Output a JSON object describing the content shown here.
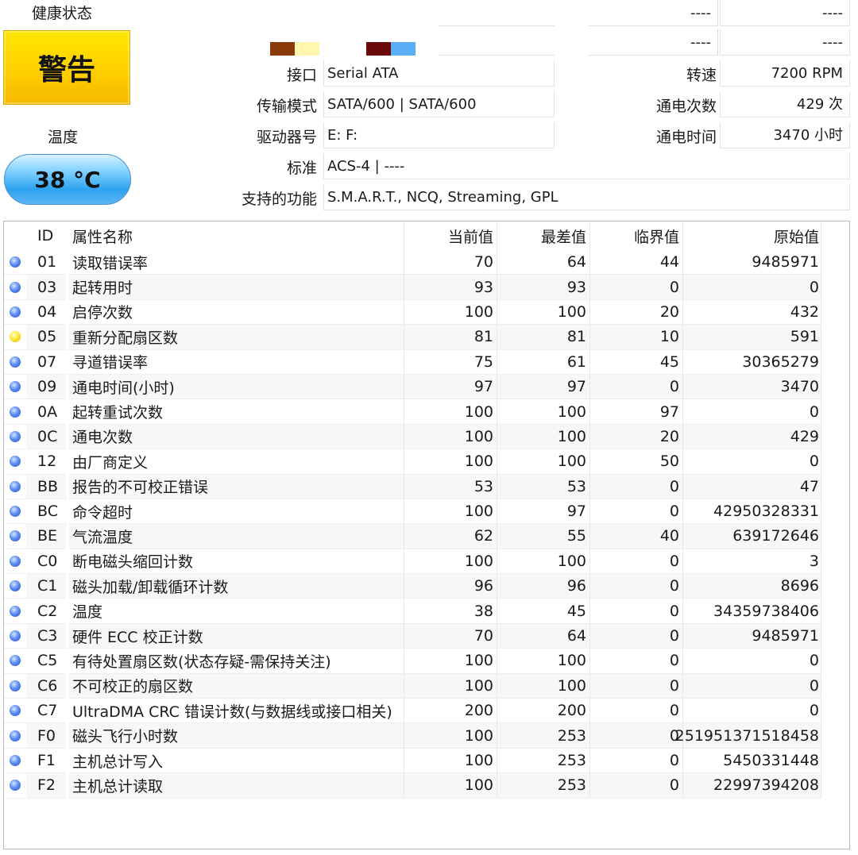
{
  "health": {
    "label": "健康状态",
    "status": "警告"
  },
  "temperature": {
    "label": "温度",
    "value": "38 °C"
  },
  "top_right": {
    "r1_left": "----",
    "r1_right": "----",
    "r2_left": "----",
    "r2_right": "----"
  },
  "swatches": [
    "#8b3a0a",
    "#fff7b0",
    "#6b0a0a",
    "#5aaef5"
  ],
  "info": {
    "interface_label": "接口",
    "interface_value": "Serial ATA",
    "transfer_label": "传输模式",
    "transfer_value": "SATA/600 | SATA/600",
    "drive_label": "驱动器号",
    "drive_value": "E: F:",
    "standard_label": "标准",
    "standard_value": "ACS-4 | ----",
    "features_label": "支持的功能",
    "features_value": "S.M.A.R.T., NCQ, Streaming, GPL",
    "rpm_label": "转速",
    "rpm_value": "7200 RPM",
    "power_count_label": "通电次数",
    "power_count_value": "429 次",
    "power_hours_label": "通电时间",
    "power_hours_value": "3470 小时"
  },
  "table": {
    "headers": {
      "id": "ID",
      "name": "属性名称",
      "current": "当前值",
      "worst": "最差值",
      "threshold": "临界值",
      "raw": "原始值"
    },
    "rows": [
      {
        "status": "good",
        "id": "01",
        "name": "读取错误率",
        "current": "70",
        "worst": "64",
        "threshold": "44",
        "raw": "9485971"
      },
      {
        "status": "good",
        "id": "03",
        "name": "起转用时",
        "current": "93",
        "worst": "93",
        "threshold": "0",
        "raw": "0"
      },
      {
        "status": "good",
        "id": "04",
        "name": "启停次数",
        "current": "100",
        "worst": "100",
        "threshold": "20",
        "raw": "432"
      },
      {
        "status": "caution",
        "id": "05",
        "name": "重新分配扇区数",
        "current": "81",
        "worst": "81",
        "threshold": "10",
        "raw": "591"
      },
      {
        "status": "good",
        "id": "07",
        "name": "寻道错误率",
        "current": "75",
        "worst": "61",
        "threshold": "45",
        "raw": "30365279"
      },
      {
        "status": "good",
        "id": "09",
        "name": "通电时间(小时)",
        "current": "97",
        "worst": "97",
        "threshold": "0",
        "raw": "3470"
      },
      {
        "status": "good",
        "id": "0A",
        "name": "起转重试次数",
        "current": "100",
        "worst": "100",
        "threshold": "97",
        "raw": "0"
      },
      {
        "status": "good",
        "id": "0C",
        "name": "通电次数",
        "current": "100",
        "worst": "100",
        "threshold": "20",
        "raw": "429"
      },
      {
        "status": "good",
        "id": "12",
        "name": "由厂商定义",
        "current": "100",
        "worst": "100",
        "threshold": "50",
        "raw": "0"
      },
      {
        "status": "good",
        "id": "BB",
        "name": "报告的不可校正错误",
        "current": "53",
        "worst": "53",
        "threshold": "0",
        "raw": "47"
      },
      {
        "status": "good",
        "id": "BC",
        "name": "命令超时",
        "current": "100",
        "worst": "97",
        "threshold": "0",
        "raw": "42950328331"
      },
      {
        "status": "good",
        "id": "BE",
        "name": "气流温度",
        "current": "62",
        "worst": "55",
        "threshold": "40",
        "raw": "639172646"
      },
      {
        "status": "good",
        "id": "C0",
        "name": "断电磁头缩回计数",
        "current": "100",
        "worst": "100",
        "threshold": "0",
        "raw": "3"
      },
      {
        "status": "good",
        "id": "C1",
        "name": "磁头加载/卸载循环计数",
        "current": "96",
        "worst": "96",
        "threshold": "0",
        "raw": "8696"
      },
      {
        "status": "good",
        "id": "C2",
        "name": "温度",
        "current": "38",
        "worst": "45",
        "threshold": "0",
        "raw": "34359738406"
      },
      {
        "status": "good",
        "id": "C3",
        "name": "硬件 ECC 校正计数",
        "current": "70",
        "worst": "64",
        "threshold": "0",
        "raw": "9485971"
      },
      {
        "status": "good",
        "id": "C5",
        "name": "有待处置扇区数(状态存疑-需保持关注)",
        "current": "100",
        "worst": "100",
        "threshold": "0",
        "raw": "0"
      },
      {
        "status": "good",
        "id": "C6",
        "name": "不可校正的扇区数",
        "current": "100",
        "worst": "100",
        "threshold": "0",
        "raw": "0"
      },
      {
        "status": "good",
        "id": "C7",
        "name": "UltraDMA CRC 错误计数(与数据线或接口相关)",
        "current": "200",
        "worst": "200",
        "threshold": "0",
        "raw": "0"
      },
      {
        "status": "good",
        "id": "F0",
        "name": "磁头飞行小时数",
        "current": "100",
        "worst": "253",
        "threshold": "0",
        "raw": "251951371518458"
      },
      {
        "status": "good",
        "id": "F1",
        "name": "主机总计写入",
        "current": "100",
        "worst": "253",
        "threshold": "0",
        "raw": "5450331448"
      },
      {
        "status": "good",
        "id": "F2",
        "name": "主机总计读取",
        "current": "100",
        "worst": "253",
        "threshold": "0",
        "raw": "22997394208"
      }
    ]
  }
}
